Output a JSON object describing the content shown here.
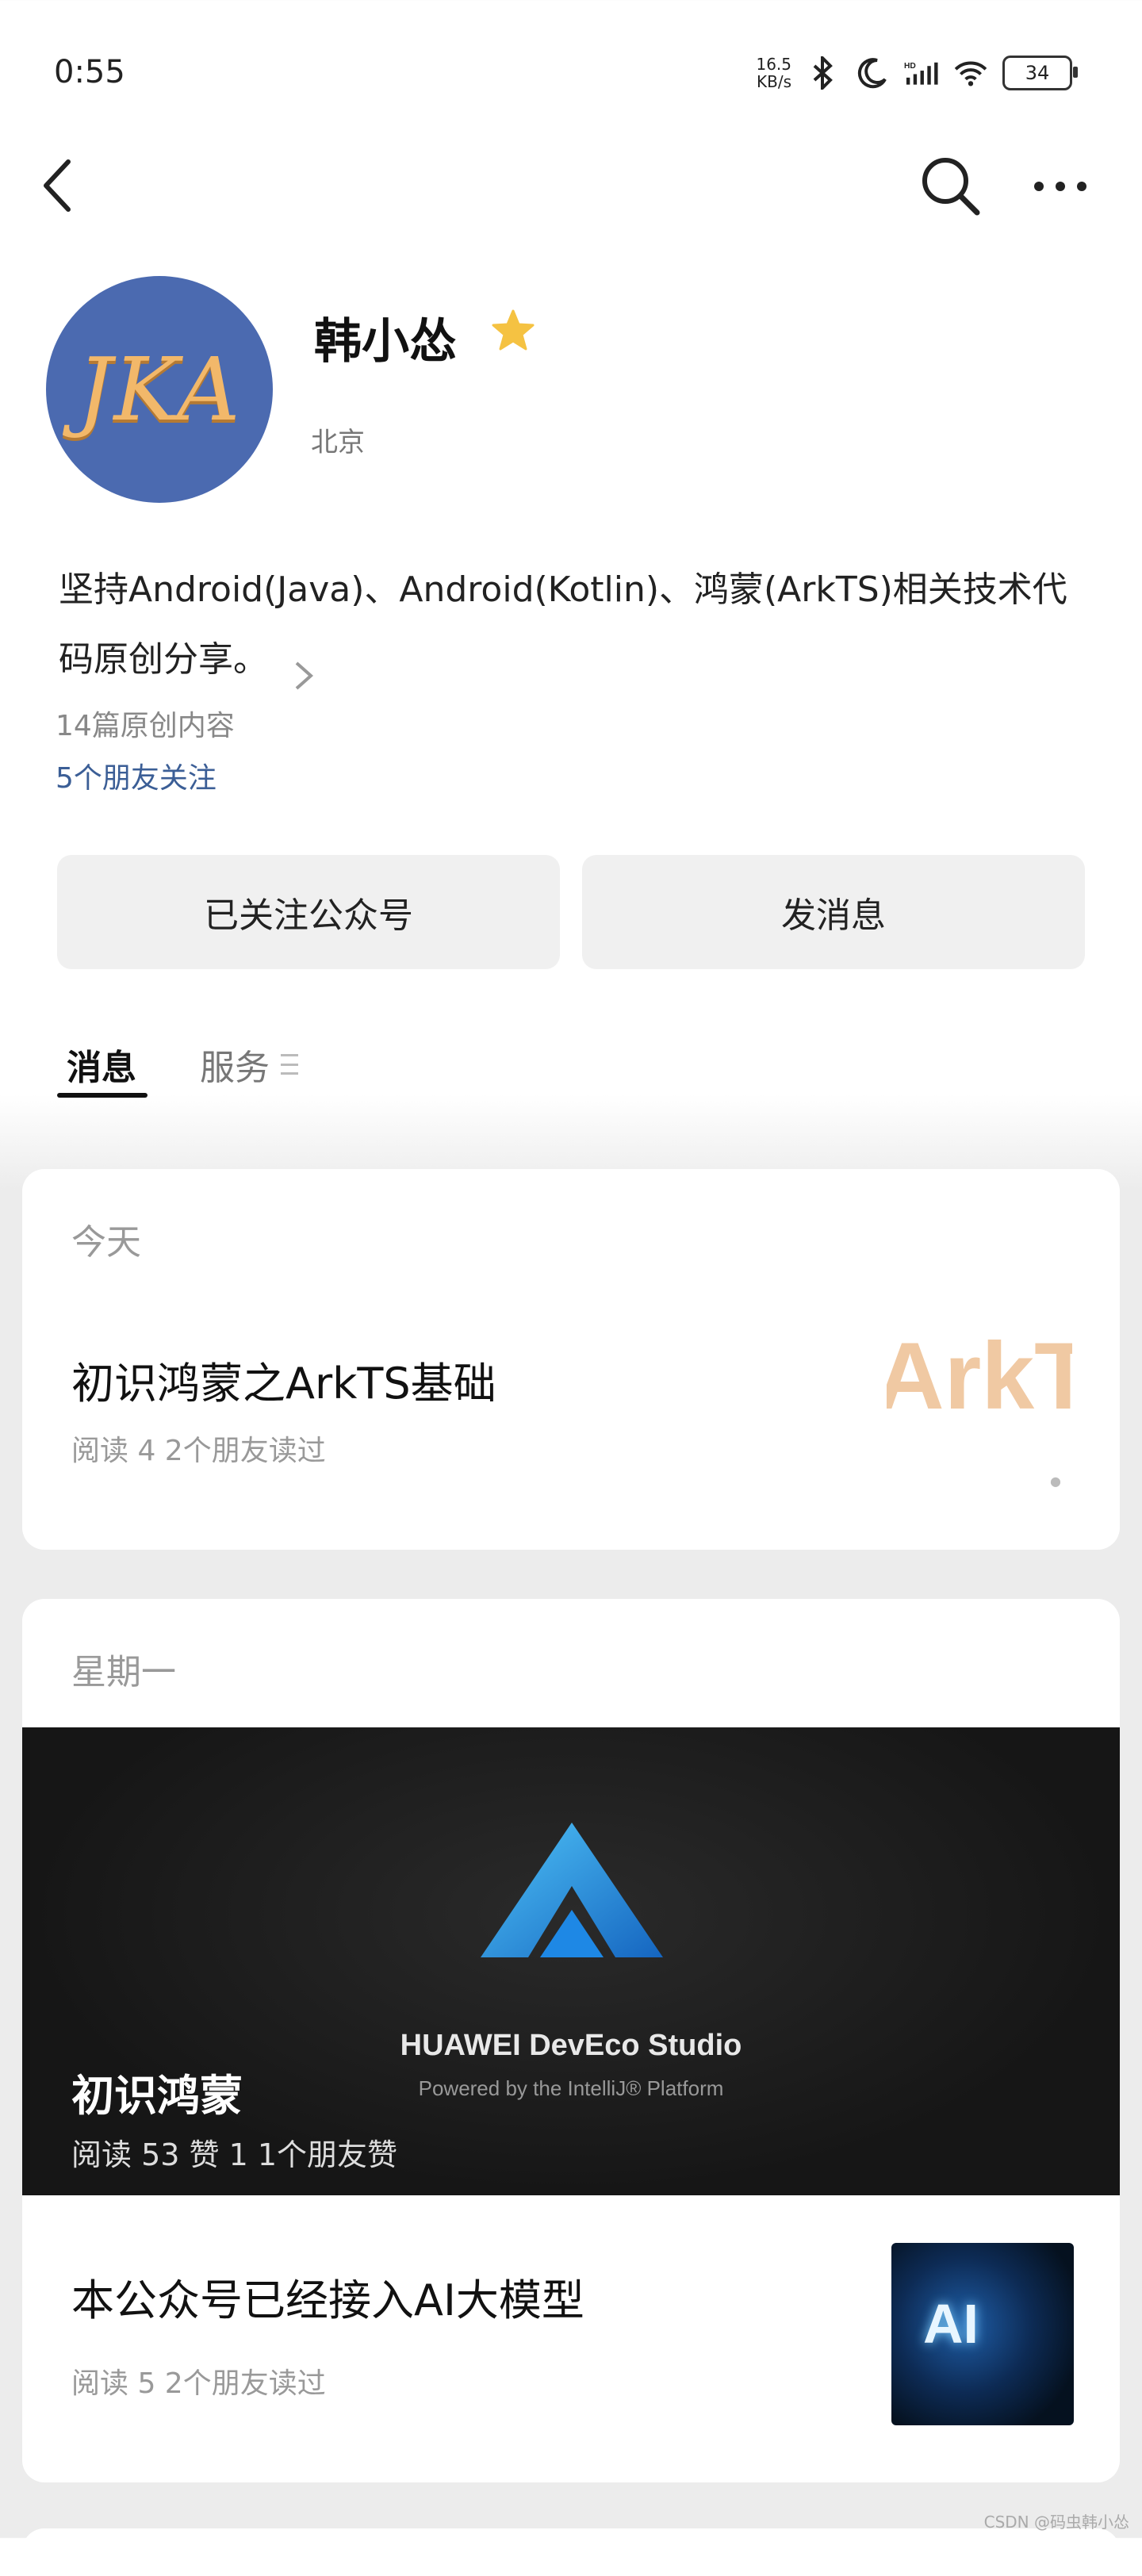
{
  "status_bar": {
    "time": "0:55",
    "speed_value": "16.5",
    "speed_unit": "KB/s",
    "battery": "34"
  },
  "profile": {
    "avatar_text": "JKA",
    "name": "韩小怂",
    "location": "北京",
    "bio": "坚持Android(Java)、Android(Kotlin)、鸿蒙(ArkTS)相关技术代码原创分享。",
    "original_count": "14篇原创内容",
    "friends_follow": "5个朋友关注"
  },
  "actions": {
    "followed": "已关注公众号",
    "message": "发消息"
  },
  "tabs": [
    {
      "label": "消息",
      "active": true
    },
    {
      "label": "服务",
      "active": false
    }
  ],
  "groups": [
    {
      "date": "今天",
      "articles": [
        {
          "title": "初识鸿蒙之ArkTS基础",
          "meta": "阅读 4  2个朋友读过",
          "thumb_text": "ArkT"
        }
      ]
    },
    {
      "date": "星期一",
      "articles": [
        {
          "title": "初识鸿蒙",
          "meta": "阅读 53   赞 1  1个朋友赞",
          "hero_brand": "HUAWEI DevEco Studio",
          "hero_sub": "Powered by the IntelliJ® Platform"
        },
        {
          "title": "本公众号已经接入AI大模型",
          "meta": "阅读 5  2个朋友读过",
          "thumb_text": "AI"
        }
      ]
    }
  ],
  "watermark": "CSDN @码虫韩小怂",
  "colors": {
    "avatar_bg": "#4b6ab0",
    "star": "#f5c242",
    "link": "#3b5e96",
    "button_bg": "#f0f0f0"
  },
  "icons": [
    "back-arrow-icon",
    "search-icon",
    "more-icon",
    "star-icon",
    "bluetooth-icon",
    "moon-icon",
    "signal-icon",
    "wifi-icon",
    "battery-icon",
    "chevron-right-icon",
    "menu-lines-icon",
    "deveco-logo-icon"
  ]
}
